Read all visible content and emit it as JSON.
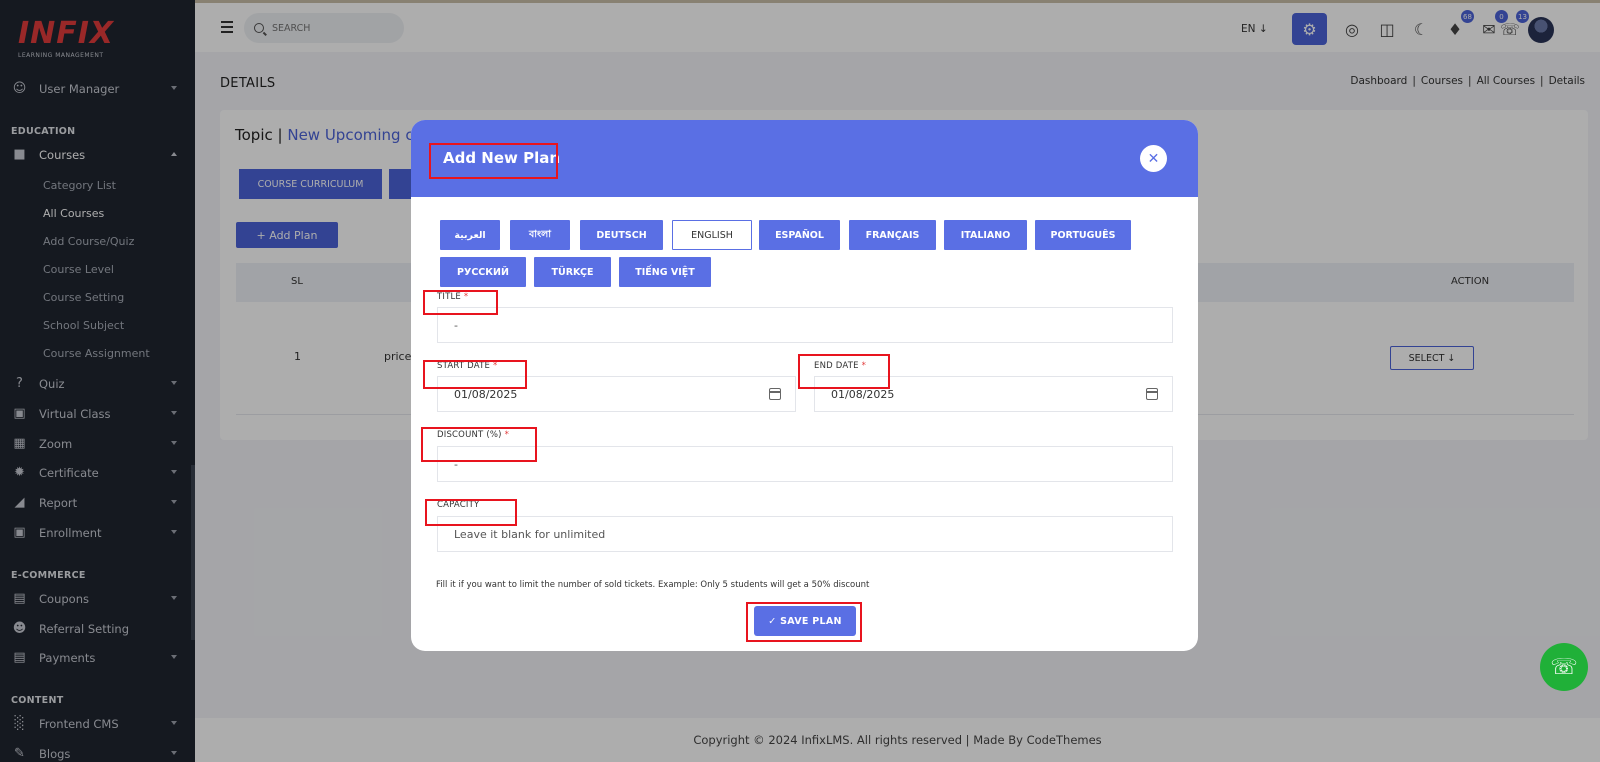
{
  "sidebar": {
    "logo_main": "INFIX",
    "logo_sub": "LEARNING MANAGEMENT",
    "user_manager": "User Manager",
    "section_education": "EDUCATION",
    "courses": "Courses",
    "course_sub": [
      "Category List",
      "All Courses",
      "Add Course/Quiz",
      "Course Level",
      "Course Setting",
      "School Subject",
      "Course Assignment"
    ],
    "quiz": "Quiz",
    "virtual_class": "Virtual Class",
    "zoom": "Zoom",
    "certificate": "Certificate",
    "report": "Report",
    "enrollment": "Enrollment",
    "section_ecommerce": "E-COMMERCE",
    "coupons": "Coupons",
    "referral": "Referral Setting",
    "payments": "Payments",
    "section_content": "CONTENT",
    "frontend_cms": "Frontend CMS",
    "blogs": "Blogs"
  },
  "topbar": {
    "search_placeholder": "SEARCH",
    "language": "EN ↓",
    "badges": {
      "notifications": "68",
      "messages": "0",
      "whatsapp": "13"
    }
  },
  "page": {
    "title": "DETAILS",
    "breadcrumb": [
      "Dashboard",
      "Courses",
      "All Courses",
      "Details"
    ],
    "breadcrumb_sep": "|",
    "topic_label": "Topic |",
    "topic_link": "New Upcoming co",
    "course_curriculum": "COURSE CURRICULUM",
    "add_plan": "+ Add Plan",
    "table": {
      "col_sl": "SL",
      "col_action": "ACTION",
      "row_sl": "1",
      "row_title": "price",
      "select": "SELECT ↓"
    }
  },
  "modal": {
    "title": "Add New Plan",
    "close": "✕",
    "languages": [
      "العربية",
      "বাংলা",
      "DEUTSCH",
      "ENGLISH",
      "ESPAÑOL",
      "FRANÇAIS",
      "ITALIANO",
      "PORTUGUÊS",
      "РУССКИЙ",
      "TÜRKÇE",
      "TIẾNG VIỆT"
    ],
    "selected_language": "ENGLISH",
    "title_label": "TITLE",
    "title_value": "-",
    "start_date_label": "START DATE",
    "start_date_value": "01/08/2025",
    "end_date_label": "END DATE",
    "end_date_value": "01/08/2025",
    "discount_label": "DISCOUNT (%)",
    "discount_value": "-",
    "capacity_label": "CAPACITY",
    "capacity_placeholder": "Leave it blank for unlimited",
    "required_mark": "*",
    "hint": "Fill it if you want to limit the number of sold tickets. Example: Only 5 students will get a 50% discount",
    "save": "✓ SAVE PLAN"
  },
  "footer": {
    "text": "Copyright © 2024 InfixLMS. All rights reserved | Made By CodeThemes"
  },
  "colors": {
    "accent": "#5a6fe4",
    "sidebar_bg": "#1f2530",
    "highlight": "#e8141e",
    "whatsapp": "#20b038"
  }
}
